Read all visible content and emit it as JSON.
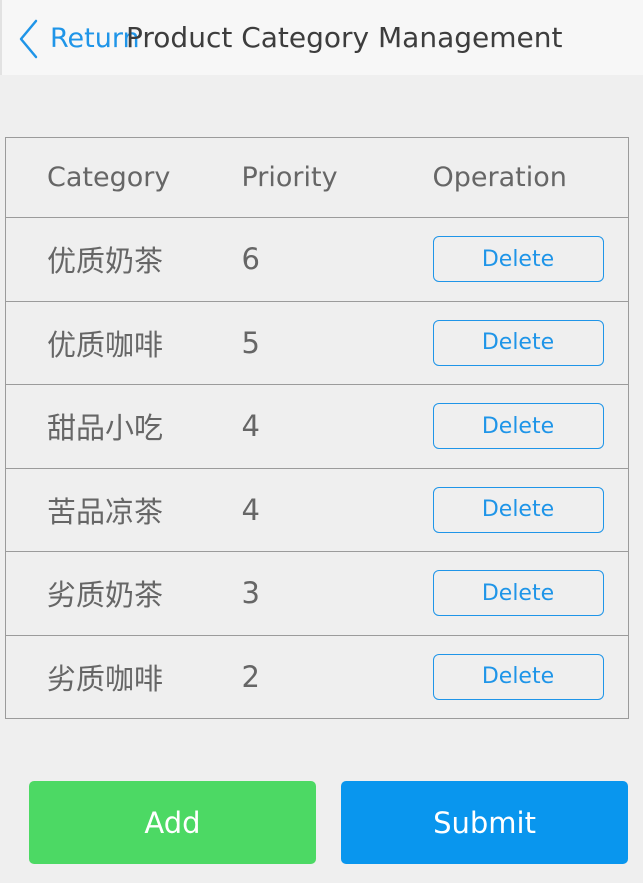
{
  "header": {
    "back_label": "Return",
    "title": "Product Category Management"
  },
  "table": {
    "columns": {
      "category": "Category",
      "priority": "Priority",
      "operation": "Operation"
    },
    "rows": [
      {
        "category": "优质奶茶",
        "priority": "6",
        "action": "Delete"
      },
      {
        "category": "优质咖啡",
        "priority": "5",
        "action": "Delete"
      },
      {
        "category": "甜品小吃",
        "priority": "4",
        "action": "Delete"
      },
      {
        "category": "苦品凉茶",
        "priority": "4",
        "action": "Delete"
      },
      {
        "category": "劣质奶茶",
        "priority": "3",
        "action": "Delete"
      },
      {
        "category": "劣质咖啡",
        "priority": "2",
        "action": "Delete"
      }
    ]
  },
  "footer": {
    "add_label": "Add",
    "submit_label": "Submit"
  },
  "colors": {
    "accent_blue": "#1f95e8",
    "submit_blue": "#0996ee",
    "add_green": "#4cd964",
    "background": "#efefef"
  },
  "icons": {
    "back": "chevron-left-icon"
  }
}
